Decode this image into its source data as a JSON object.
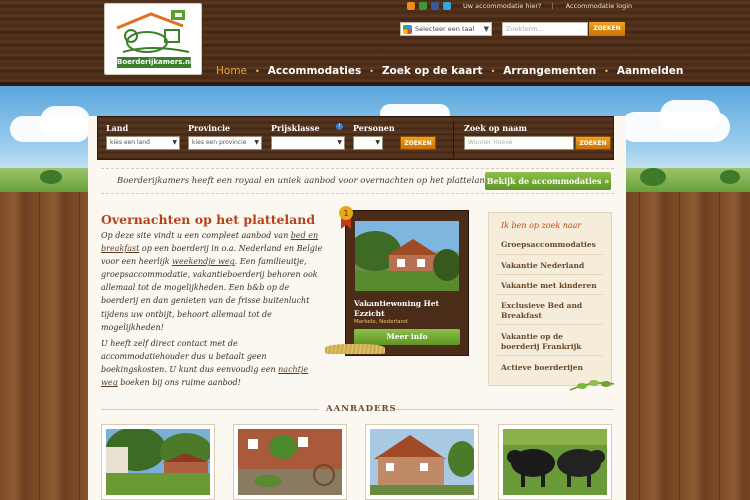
{
  "header": {
    "logo_text": "Boerderijkamers.nl",
    "toplinks": {
      "uw_accommodatie": "Uw accommodatie hier?",
      "login": "Accommodatie login"
    },
    "language_select": "Selecteer een taal",
    "search_placeholder": "Zoekterm...",
    "search_button": "ZOEKEN"
  },
  "nav": {
    "items": [
      {
        "label": "Home",
        "active": true
      },
      {
        "label": "Accommodaties"
      },
      {
        "label": "Zoek op de kaart"
      },
      {
        "label": "Arrangementen"
      },
      {
        "label": "Aanmelden"
      }
    ]
  },
  "searchbar": {
    "land_label": "Land",
    "land_value": "kies een land",
    "provincie_label": "Provincie",
    "provincie_value": "kies een provincie",
    "prijsklasse_label": "Prijsklasse",
    "prijsklasse_value": "",
    "personen_label": "Personen",
    "personen_value": "",
    "info": "i",
    "search_button": "ZOEKEN",
    "naam_label": "Zoek op naam",
    "naam_placeholder": "Wunner Hoeve",
    "naam_button": "ZOEKEN"
  },
  "promo": {
    "text": "Boerderijkamers heeft een royaal en uniek aanbod voor overnachten op het platteland",
    "button": "Bekijk de accommodaties »"
  },
  "main": {
    "title": "Overnachten op het platteland",
    "p1_a": "Op deze site vindt u een compleet aanbod van ",
    "p1_link1": "bed en breakfast",
    "p1_b": " op een boerderij in o.a. Nederland en Belgie voor een heerlijk ",
    "p1_link2": "weekendje weg",
    "p1_c": ". Een familieuitje, groepsaccommodatie, vakantieboerderij behoren ook allemaal tot de mogelijkheden. Een b&b op de boerderij en dan genieten van de frisse buitenlucht tijdens uw ontbijt, behoort allemaal tot de mogelijkheden!",
    "p2_a": "U heeft zelf direct contact met de accommodatiehouder dus u betaalt geen boekingskosten. U kunt dus eenvoudig een ",
    "p2_link": "nachtje weg",
    "p2_b": " boeken bij ons ruime aanbod!"
  },
  "feature": {
    "badge": "1",
    "title": "Vakantiewoning Het Ezzicht",
    "subtitle": "Markelo, Nederland",
    "button": "Meer info"
  },
  "sidebar": {
    "title": "Ik ben op zoek naar",
    "items": [
      "Groepsaccommodaties",
      "Vakantie Nederland",
      "Vakantie met kinderen",
      "Exclusieve Bed and Breakfast",
      "Vakantie op de boerderij Frankrijk",
      "Actieve boerderijen"
    ]
  },
  "aanraders": {
    "title": "AANRADERS"
  },
  "colors": {
    "accent": "#b5421a",
    "green": "#6ea332",
    "orange": "#e08a10",
    "wood": "#4a2c18"
  }
}
